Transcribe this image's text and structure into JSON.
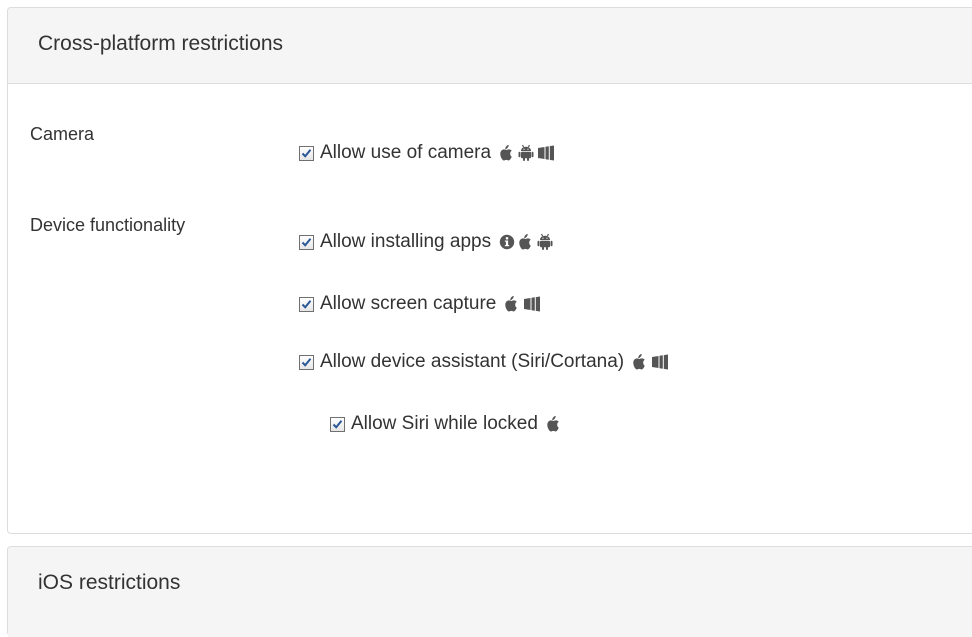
{
  "sections": {
    "cross_platform": {
      "title": "Cross-platform restrictions",
      "rows": [
        {
          "label": "Camera",
          "options": [
            {
              "label": "Allow use of camera",
              "checked": true,
              "icons": [
                "apple-icon",
                "android-icon",
                "windows-icon"
              ]
            }
          ]
        },
        {
          "label": "Device functionality",
          "options": [
            {
              "label": "Allow installing apps",
              "checked": true,
              "icons": [
                "info-icon",
                "apple-icon",
                "android-icon"
              ]
            },
            {
              "label": "Allow screen capture",
              "checked": true,
              "icons": [
                "apple-icon",
                "windows-icon"
              ]
            },
            {
              "label": "Allow device assistant (Siri/Cortana)",
              "checked": true,
              "icons": [
                "apple-icon",
                "windows-icon"
              ]
            },
            {
              "label": "Allow Siri while locked",
              "checked": true,
              "icons": [
                "apple-icon"
              ]
            }
          ]
        }
      ]
    },
    "ios": {
      "title": "iOS restrictions"
    }
  },
  "colors": {
    "icon": "#555555",
    "checkmark": "#2b5797",
    "panel_heading_bg": "#f5f5f5",
    "border": "#dddddd"
  }
}
